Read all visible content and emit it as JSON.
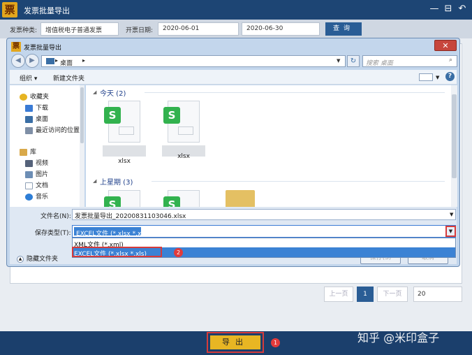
{
  "app": {
    "logo_char": "票",
    "title": "发票批量导出",
    "controls": {
      "minimize": "—",
      "restore": "⊟",
      "back": "↶"
    }
  },
  "filters": {
    "type_label": "发票种类:",
    "type_value": "增值税电子普通发票",
    "date_label": "开票日期:",
    "date_start": "2020-06-01",
    "date_end": "2020-06-30",
    "query_button": "查询"
  },
  "pagination": {
    "prev": "上一页",
    "current": "1",
    "next": "下一页",
    "page_size": "20"
  },
  "footer": {
    "export_button": "导出",
    "export_badge": "1",
    "watermark": "知乎 @米印盒子"
  },
  "dialog": {
    "title": "发票批量导出",
    "close": "✕",
    "address": "桌面",
    "address_sep": "▸",
    "search_placeholder": "搜索 桌面",
    "toolbar": {
      "organize": "组织 ▾",
      "new_folder": "新建文件夹",
      "help": "?"
    },
    "nav": {
      "favorites": "收藏夹",
      "downloads": "下载",
      "desktop": "桌面",
      "recent": "最近访问的位置",
      "library": "库",
      "videos": "视频",
      "pictures": "图片",
      "documents": "文档",
      "music": "音乐"
    },
    "groups": [
      {
        "label": "今天 (2)",
        "files": [
          "xlsx",
          "xlsx"
        ]
      },
      {
        "label": "上星期 (3)"
      }
    ],
    "file_icon_letter": "S",
    "filename_label": "文件名(N):",
    "filename_value": "发票批量导出_20200831103046.xlsx",
    "filetype_label": "保存类型(T):",
    "filetype_value": "EXCEL文件 (*.xlsx *.xls)",
    "options": [
      "XML文件 (*.xml)",
      "EXCEL文件 (*.xlsx *.xls)"
    ],
    "option_badge": "2",
    "hide_folders": "隐藏文件夹",
    "save_button": "保存(S)",
    "cancel_button": "取消"
  }
}
